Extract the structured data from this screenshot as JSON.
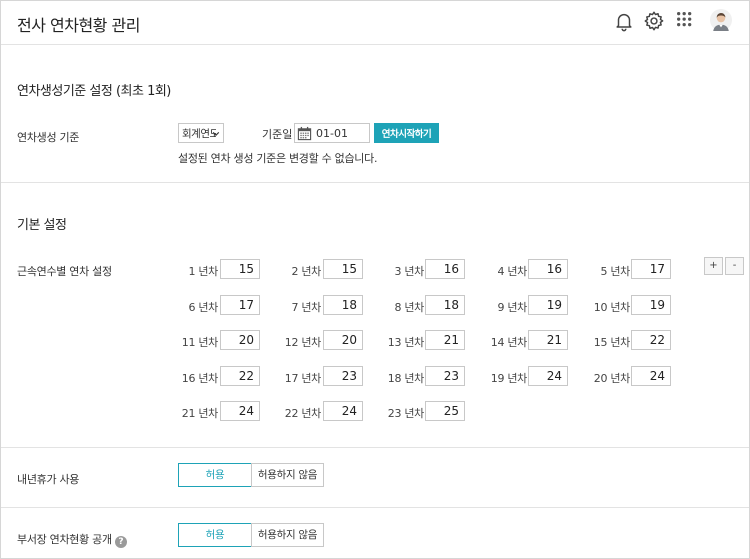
{
  "header": {
    "title": "전사 연차현황 관리",
    "icons": [
      "bell-icon",
      "gear-icon",
      "grid-apps-icon",
      "avatar"
    ]
  },
  "creation_section": {
    "title": "연차생성기준 설정 (최초 1회)",
    "row_label": "연차생성 기준",
    "select_value": "회계연도 기",
    "base_date_label": "기준일",
    "base_date_value": "01-01",
    "start_button": "연차시작하기",
    "notice": "설정된 연차 생성 기준은 변경할 수 없습니다."
  },
  "basic_section": {
    "title": "기본 설정",
    "row_label": "근속연수별 연차 설정",
    "plus_label": "+",
    "minus_label": "-",
    "years": [
      {
        "label": "1 년차",
        "value": "15"
      },
      {
        "label": "2 년차",
        "value": "15"
      },
      {
        "label": "3 년차",
        "value": "16"
      },
      {
        "label": "4 년차",
        "value": "16"
      },
      {
        "label": "5 년차",
        "value": "17"
      },
      {
        "label": "6 년차",
        "value": "17"
      },
      {
        "label": "7 년차",
        "value": "18"
      },
      {
        "label": "8 년차",
        "value": "18"
      },
      {
        "label": "9 년차",
        "value": "19"
      },
      {
        "label": "10 년차",
        "value": "19"
      },
      {
        "label": "11 년차",
        "value": "20"
      },
      {
        "label": "12 년차",
        "value": "20"
      },
      {
        "label": "13 년차",
        "value": "21"
      },
      {
        "label": "14 년차",
        "value": "21"
      },
      {
        "label": "15 년차",
        "value": "22"
      },
      {
        "label": "16 년차",
        "value": "22"
      },
      {
        "label": "17 년차",
        "value": "23"
      },
      {
        "label": "18 년차",
        "value": "23"
      },
      {
        "label": "19 년차",
        "value": "24"
      },
      {
        "label": "20 년차",
        "value": "24"
      },
      {
        "label": "21 년차",
        "value": "24"
      },
      {
        "label": "22 년차",
        "value": "24"
      },
      {
        "label": "23 년차",
        "value": "25"
      }
    ]
  },
  "next_year_leave": {
    "label": "내년휴가 사용",
    "allow": "허용",
    "disallow": "허용하지 않음",
    "selected": "allow"
  },
  "dept_status": {
    "label": "부서장 연차현황 공개",
    "help": "?",
    "allow": "허용",
    "disallow": "허용하지 않음",
    "selected": "allow"
  },
  "colors": {
    "accent": "#1ea3b7",
    "border": "#c8c8c8",
    "divider": "#e3e3e3"
  }
}
